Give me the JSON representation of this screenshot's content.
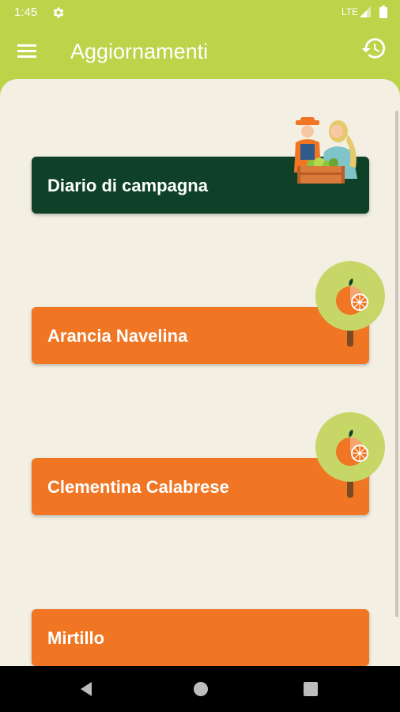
{
  "status_bar": {
    "time": "1:45",
    "network": "LTE",
    "icons": [
      "settings-gear-icon",
      "signal-icon",
      "battery-icon"
    ]
  },
  "app_bar": {
    "title": "Aggiornamenti",
    "icons": [
      "hamburger-menu-icon",
      "history-icon"
    ]
  },
  "cards": [
    {
      "label": "Diario di campagna",
      "color": "#0e4128",
      "illustration": "farmers-with-crate-illustration"
    },
    {
      "label": "Arancia Navelina",
      "color": "#f07624",
      "illustration": "orange-tree-icon"
    },
    {
      "label": "Clementina Calabrese",
      "color": "#f07624",
      "illustration": "orange-tree-icon"
    },
    {
      "label": "Mirtillo",
      "color": "#f07624"
    }
  ],
  "colors": {
    "accent": "#bcd34a",
    "background": "#f3efe3",
    "orange": "#f07624",
    "dark_green": "#0e4128"
  },
  "nav_bar": {
    "icons": [
      "back-icon",
      "home-icon",
      "recents-icon"
    ]
  }
}
